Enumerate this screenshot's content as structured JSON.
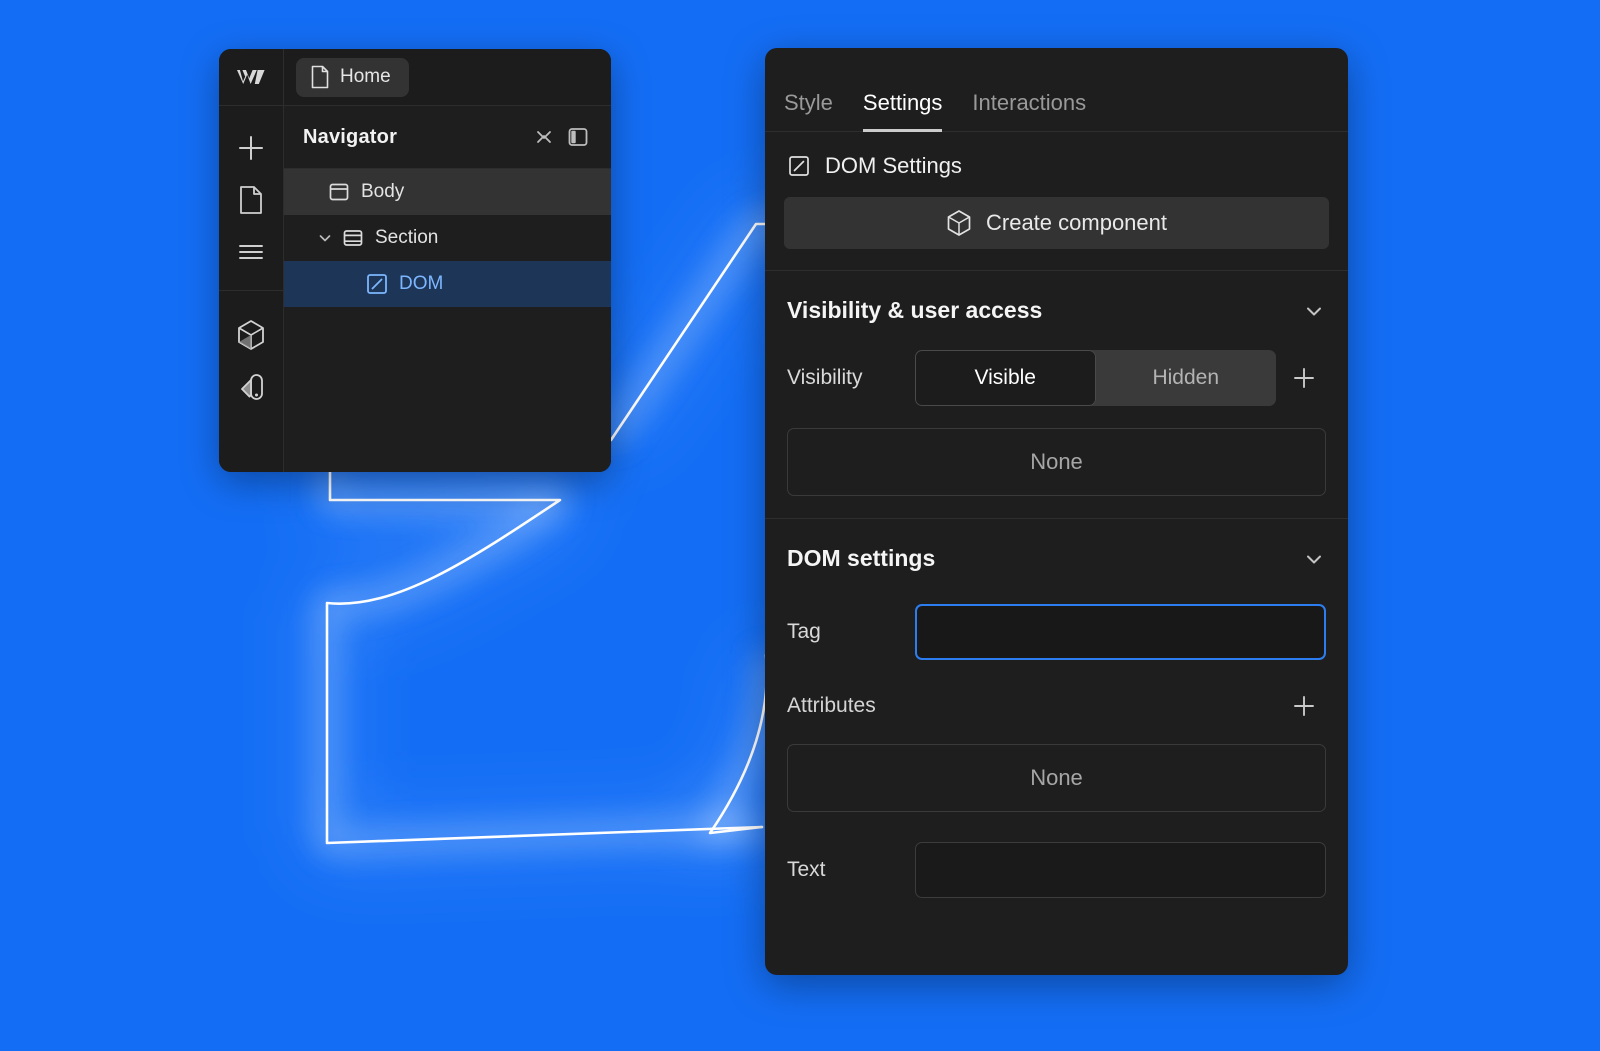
{
  "theme": {
    "background_blue": "#146ef5",
    "panel_bg": "#1e1e1e",
    "selected_row_bg": "#1d3557",
    "selected_row_text": "#7cb6ff",
    "focus_border": "#2c7ef0"
  },
  "left_window": {
    "rail": {
      "logo": "webflow-logo",
      "upper_items": [
        {
          "icon": "plus-icon",
          "name": "add-element"
        },
        {
          "icon": "page-icon",
          "name": "pages"
        },
        {
          "icon": "navigator-lines-icon",
          "name": "navigator"
        }
      ],
      "lower_items": [
        {
          "icon": "cube-icon",
          "name": "components"
        },
        {
          "icon": "style-swatch-icon",
          "name": "style-selectors"
        }
      ]
    },
    "tabbar": {
      "home_tab": "Home",
      "home_icon": "page-icon"
    },
    "navigator": {
      "title": "Navigator",
      "close_icon": "close-x-icon",
      "layout_icon": "panel-layout-icon",
      "tree": [
        {
          "label": "Body",
          "icon": "body-box-icon",
          "depth": 0,
          "selected": false,
          "highlighted": true,
          "caret": ""
        },
        {
          "label": "Section",
          "icon": "section-box-icon",
          "depth": 1,
          "selected": false,
          "highlighted": false,
          "caret": "chevron-down-icon"
        },
        {
          "label": "DOM",
          "icon": "dom-slash-icon",
          "depth": 2,
          "selected": true,
          "highlighted": false,
          "caret": ""
        }
      ]
    }
  },
  "right_panel": {
    "tabs": [
      {
        "label": "Style",
        "active": false
      },
      {
        "label": "Settings",
        "active": true
      },
      {
        "label": "Interactions",
        "active": false
      }
    ],
    "dom_settings_header": {
      "icon": "dom-slash-icon",
      "label": "DOM Settings"
    },
    "create_component_button": {
      "label": "Create component",
      "icon": "cube-icon"
    },
    "visibility_section": {
      "title": "Visibility & user access",
      "collapse_icon": "chevron-down-icon",
      "field_label": "Visibility",
      "options": [
        {
          "label": "Visible",
          "selected": true
        },
        {
          "label": "Hidden",
          "selected": false
        }
      ],
      "add_icon": "plus-icon",
      "empty_value": "None"
    },
    "dom_section": {
      "title": "DOM settings",
      "collapse_icon": "chevron-down-icon",
      "tag": {
        "label": "Tag",
        "value": "",
        "placeholder": "",
        "focused": true
      },
      "attributes": {
        "label": "Attributes",
        "add_icon": "plus-icon",
        "empty_value": "None"
      },
      "text": {
        "label": "Text",
        "value": "",
        "placeholder": ""
      }
    }
  }
}
